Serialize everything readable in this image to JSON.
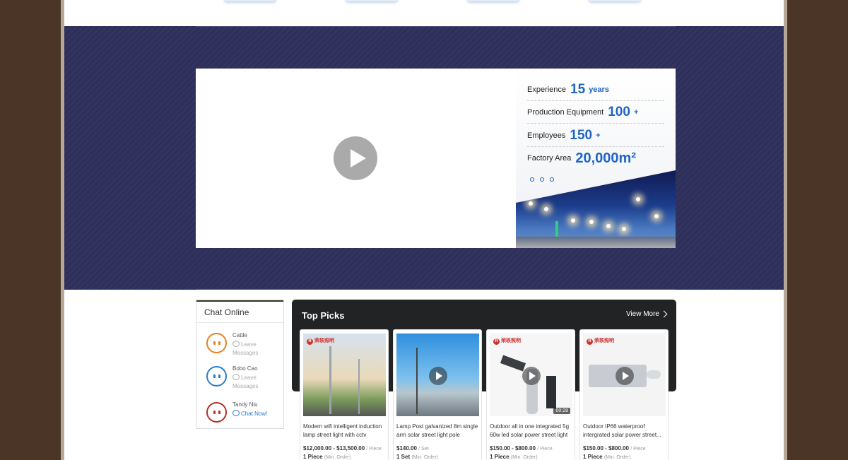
{
  "hero": {
    "stats": [
      {
        "label": "Experience",
        "value": "15",
        "unit": "years"
      },
      {
        "label": "Production Equipment",
        "value": "100",
        "unit": "+"
      },
      {
        "label": "Employees",
        "value": "150",
        "unit": "+"
      },
      {
        "label": "Factory Area",
        "value": "20,000m²",
        "unit": ""
      }
    ]
  },
  "chat": {
    "title": "Chat Online",
    "agents": [
      {
        "name": "Cattle",
        "action": "Leave Messages",
        "color": "#e8801c",
        "online": false
      },
      {
        "name": "Bobo Cao",
        "action": "Leave Messages",
        "color": "#2a7bd6",
        "online": false
      },
      {
        "name": "Tandy Niu",
        "action": "Chat Now!",
        "color": "#b4302a",
        "online": true
      }
    ]
  },
  "top_picks": {
    "title": "Top Picks",
    "view_more": "View More",
    "products": [
      {
        "desc": "Modern wifi intelligent induction lamp street light with cctv camera",
        "price": "$12,000.00 - $13,500.00",
        "price_unit": "/ Piece",
        "moq": "1 Piece",
        "moq_unit": "(Min. Order)",
        "brand": "荣轶照明",
        "video": false,
        "duration": ""
      },
      {
        "desc": "Lamp Post galvanized 8m single arm solar street light pole",
        "price": "$140.00",
        "price_unit": "/ Set",
        "moq": "1 Set",
        "moq_unit": "(Min. Order)",
        "brand": "",
        "video": true,
        "duration": ""
      },
      {
        "desc": "Outdoor all in one integrated 5g 60w led solar power street light",
        "price": "$150.00 - $800.00",
        "price_unit": "/ Piece",
        "moq": "1 Piece",
        "moq_unit": "(Min. Order)",
        "brand": "荣轶照明",
        "video": true,
        "duration": "00:28"
      },
      {
        "desc": "Outdoor IP66 waterproof intergrated solar power street...",
        "price": "$150.00 - $800.00",
        "price_unit": "/ Piece",
        "moq": "1 Piece",
        "moq_unit": "(Min. Order)",
        "brand": "荣轶照明",
        "video": true,
        "duration": ""
      }
    ]
  },
  "colors": {
    "accent": "#1f64c4",
    "band": "#2e2f5a",
    "outer": "#4a3526"
  }
}
